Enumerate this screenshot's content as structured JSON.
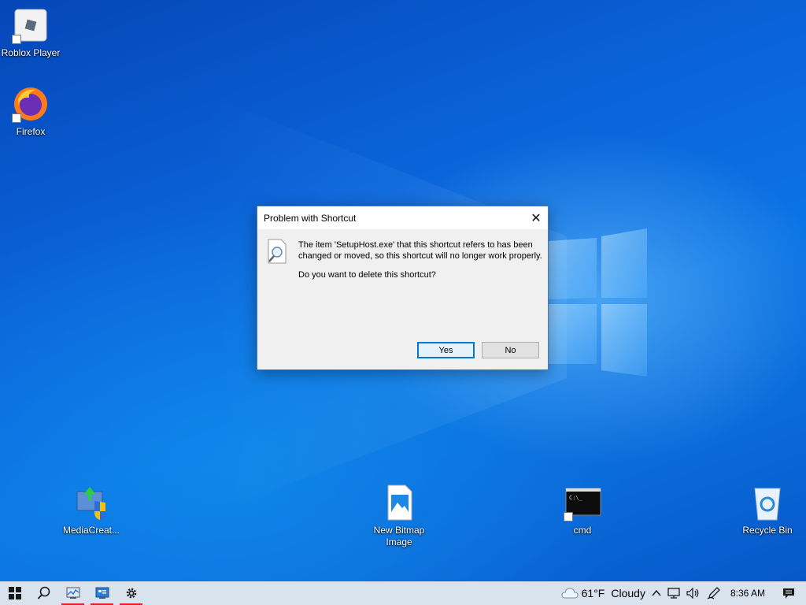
{
  "desktop": {
    "icons": [
      {
        "name": "roblox-player",
        "label": "Roblox Player"
      },
      {
        "name": "firefox",
        "label": "Firefox"
      },
      {
        "name": "media-creation-tool",
        "label": "MediaCreat..."
      },
      {
        "name": "new-bitmap-image",
        "label": "New Bitmap Image"
      },
      {
        "name": "cmd",
        "label": "cmd"
      },
      {
        "name": "recycle-bin",
        "label": "Recycle Bin"
      }
    ]
  },
  "dialog": {
    "title": "Problem with Shortcut",
    "message": "The item 'SetupHost.exe' that this shortcut refers to has been changed or moved, so this shortcut will no longer work properly.",
    "question": "Do you want to delete this shortcut?",
    "yes_label": "Yes",
    "no_label": "No",
    "close_glyph": "✕"
  },
  "taskbar": {
    "weather_temp": "61°F",
    "weather_condition": "Cloudy",
    "clock": "8:36 AM",
    "underline_color": "#e0202a"
  }
}
